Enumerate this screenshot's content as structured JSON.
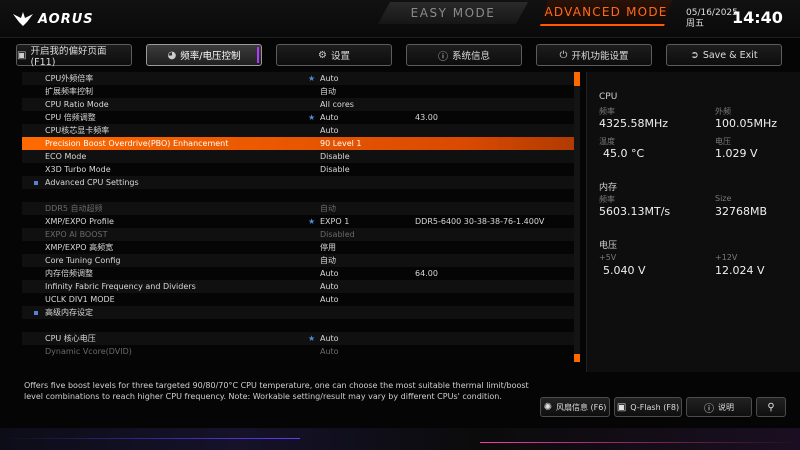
{
  "header": {
    "brand": "AORUS",
    "easy_mode": "EASY MODE",
    "advanced_mode": "ADVANCED MODE",
    "date": "05/16/2025",
    "weekday": "周五",
    "time": "14:40"
  },
  "tabs": [
    {
      "label": "开启我的偏好页面 (F11)",
      "icon": "favorite-page-icon"
    },
    {
      "label": "频率/电压控制",
      "icon": "gauge-icon"
    },
    {
      "label": "设置",
      "icon": "gear-icon"
    },
    {
      "label": "系统信息",
      "icon": "info-icon"
    },
    {
      "label": "开机功能设置",
      "icon": "power-icon"
    },
    {
      "label": "Save & Exit",
      "icon": "save-exit-icon"
    }
  ],
  "settings": [
    {
      "label": "CPU外频倍率",
      "star": true,
      "value": "Auto",
      "value2": ""
    },
    {
      "label": "扩展频率控制",
      "star": false,
      "value": "自动",
      "value2": ""
    },
    {
      "label": "CPU Ratio Mode",
      "star": false,
      "value": "All cores",
      "value2": ""
    },
    {
      "label": "CPU 倍频调整",
      "star": true,
      "value": "Auto",
      "value2": "43.00"
    },
    {
      "label": "CPU核芯显卡频率",
      "star": false,
      "value": "Auto",
      "value2": ""
    },
    {
      "label": "Precision Boost Overdrive(PBO) Enhancement",
      "star": false,
      "value": "90 Level 1",
      "value2": "",
      "selected": true
    },
    {
      "label": "ECO Mode",
      "star": false,
      "value": "Disable",
      "value2": ""
    },
    {
      "label": "X3D Turbo Mode",
      "star": false,
      "value": "Disable",
      "value2": ""
    },
    {
      "label": "Advanced CPU Settings",
      "star": false,
      "value": "",
      "value2": "",
      "section": true
    },
    {
      "label": "",
      "star": false,
      "value": "",
      "value2": "",
      "spacer": true
    },
    {
      "label": "DDR5 自动超频",
      "star": false,
      "value": "自动",
      "value2": "",
      "gray": true
    },
    {
      "label": "XMP/EXPO Profile",
      "star": true,
      "value": "EXPO 1",
      "value2": "DDR5-6400 30-38-38-76-1.400V"
    },
    {
      "label": "EXPO AI BOOST",
      "star": false,
      "value": "Disabled",
      "value2": "",
      "gray": true
    },
    {
      "label": "XMP/EXPO 高频宽",
      "star": false,
      "value": "停用",
      "value2": ""
    },
    {
      "label": "Core Tuning Config",
      "star": false,
      "value": "自动",
      "value2": ""
    },
    {
      "label": "内存倍频调整",
      "star": false,
      "value": "Auto",
      "value2": "64.00"
    },
    {
      "label": "Infinity Fabric Frequency and Dividers",
      "star": false,
      "value": "Auto",
      "value2": ""
    },
    {
      "label": "UCLK DIV1 MODE",
      "star": false,
      "value": "Auto",
      "value2": ""
    },
    {
      "label": "高级内存设定",
      "star": false,
      "value": "",
      "value2": "",
      "section": true
    },
    {
      "label": "",
      "star": false,
      "value": "",
      "value2": "",
      "spacer": true
    },
    {
      "label": "CPU 核心电压",
      "star": true,
      "value": "Auto",
      "value2": ""
    },
    {
      "label": "Dynamic Vcore(DVID)",
      "star": false,
      "value": "Auto",
      "value2": "",
      "gray": true
    }
  ],
  "side": {
    "cpu_title": "CPU",
    "freq_label": "频率",
    "freq_value": "4325.58MHz",
    "bclk_label": "外频",
    "bclk_value": "100.05MHz",
    "temp_label": "温度",
    "temp_value": "45.0 °C",
    "volt_label": "电压",
    "volt_value": "1.029 V",
    "mem_title": "内存",
    "mem_freq_label": "频率",
    "mem_freq_value": "5603.13MT/s",
    "mem_size_label": "Size",
    "mem_size_value": "32768MB",
    "power_title": "电压",
    "p5v_label": "+5V",
    "p5v_value": "5.040 V",
    "p12v_label": "+12V",
    "p12v_value": "12.024 V"
  },
  "help_text": "Offers five boost levels for three targeted 90/80/70°C CPU temperature, one can choose the most suitable thermal limit/boost level combinations to reach higher CPU frequency. Note: Workable setting/result may vary by different CPUs' condition.",
  "bottom_buttons": [
    {
      "label": "风扇信息 (F6)",
      "icon": "fan-icon"
    },
    {
      "label": "Q-Flash (F8)",
      "icon": "qflash-icon"
    },
    {
      "label": "说明",
      "icon": "help-icon"
    },
    {
      "label": "",
      "icon": "search-icon"
    }
  ]
}
